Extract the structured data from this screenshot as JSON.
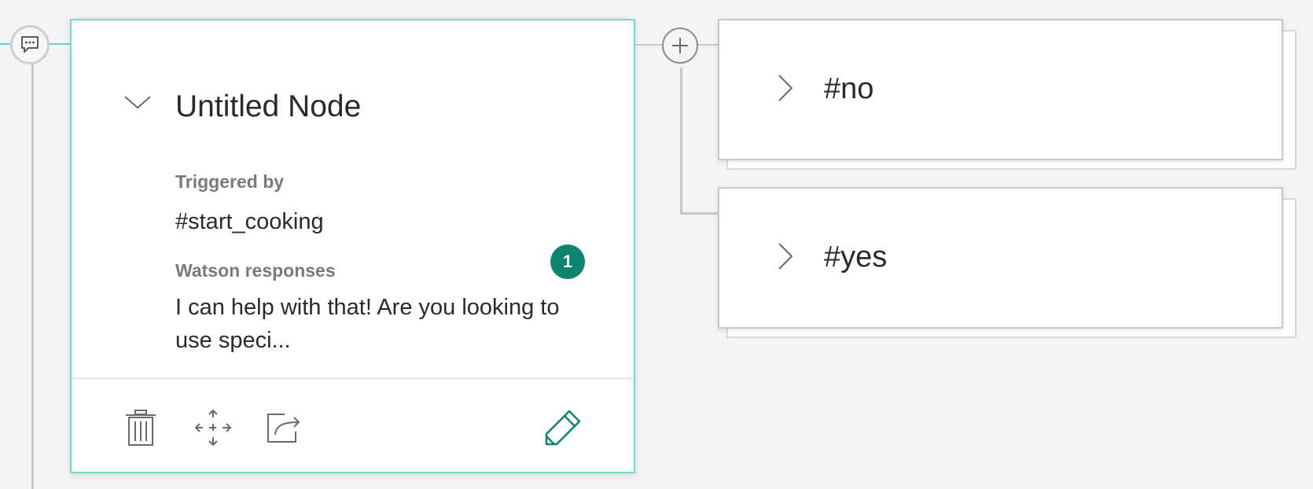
{
  "node": {
    "title": "Untitled Node",
    "triggered_by_label": "Triggered by",
    "trigger_value": "#start_cooking",
    "responses_label": "Watson responses",
    "response_count": "1",
    "response_preview": "I can help with that! Are you looking to use speci..."
  },
  "children": [
    {
      "label": "#no"
    },
    {
      "label": "#yes"
    }
  ],
  "icons": {
    "node_type": "chat-bubble-icon",
    "add_child": "plus-icon",
    "collapse": "chevron-down-icon",
    "expand": "chevron-right-icon",
    "delete": "trash-icon",
    "move": "move-arrows-icon",
    "jump": "jump-to-icon",
    "edit": "pencil-icon"
  },
  "colors": {
    "accent": "#0c8470",
    "selected_border": "#69e0cb",
    "connector": "#c8c8c8"
  }
}
